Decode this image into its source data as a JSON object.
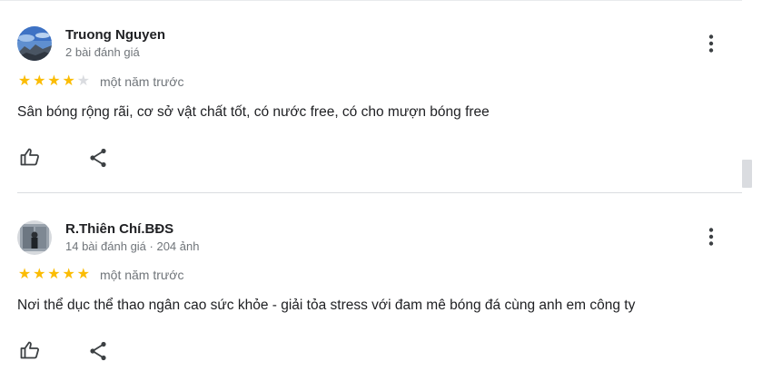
{
  "reviews": [
    {
      "name": "Truong Nguyen",
      "meta": "2 bài đánh giá",
      "rating": 4,
      "time": "một năm trước",
      "text": "Sân bóng rộng rãi, cơ sở vật chất tốt, có nước free, có cho mượn bóng free",
      "icons": [
        "avatar",
        "more-vert-icon",
        "thumb-up-icon",
        "share-icon"
      ]
    },
    {
      "name": "R.Thiên Chí.BĐS",
      "meta": "14 bài đánh giá · 204 ảnh",
      "rating": 5,
      "time": "một năm trước",
      "text": "Nơi thể dục thể thao ngân cao sức khỏe - giải tỏa stress với đam mê bóng đá cùng anh em công ty",
      "icons": [
        "avatar",
        "more-vert-icon",
        "thumb-up-icon",
        "share-icon"
      ]
    }
  ],
  "colors": {
    "star": "#fbbc04",
    "star_empty": "#dadce0",
    "divider": "#dadce0",
    "meta_text": "#70757a",
    "icon": "#5f6368"
  }
}
